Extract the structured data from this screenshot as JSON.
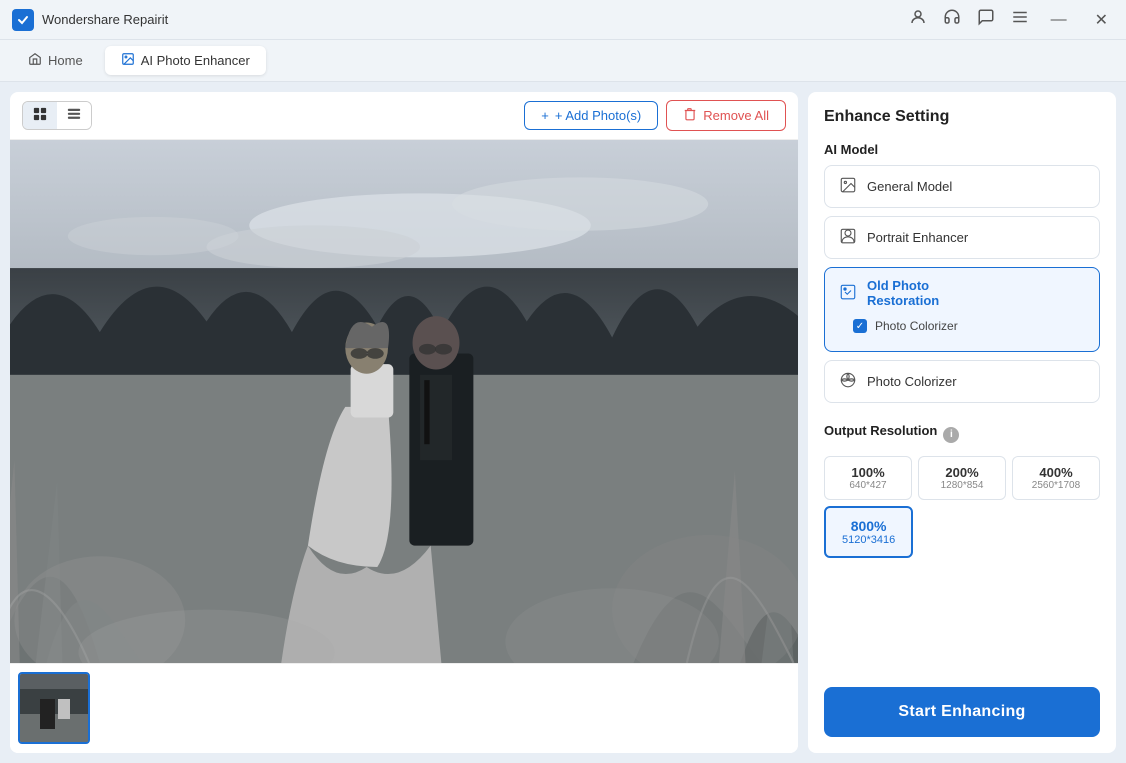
{
  "app": {
    "name": "Wondershare Repairit",
    "icon": "W"
  },
  "titlebar": {
    "controls": {
      "user_icon": "👤",
      "headphone_icon": "🎧",
      "chat_icon": "💬",
      "menu_icon": "☰",
      "minimize": "—",
      "close": "✕"
    }
  },
  "nav": {
    "home_label": "Home",
    "active_tab_label": "AI Photo Enhancer"
  },
  "toolbar": {
    "grid_view_active": true,
    "add_label": "+ Add Photo(s)",
    "remove_label": "Remove All"
  },
  "right_panel": {
    "title": "Enhance Setting",
    "ai_model_label": "AI Model",
    "models": [
      {
        "id": "general",
        "label": "General Model",
        "selected": false
      },
      {
        "id": "portrait",
        "label": "Portrait Enhancer",
        "selected": false
      },
      {
        "id": "old_photo",
        "label": "Old Photo Restoration",
        "selected": true
      },
      {
        "id": "colorizer",
        "label": "Photo Colorizer",
        "selected": false
      }
    ],
    "photo_colorizer_checkbox": {
      "label": "Photo Colorizer",
      "checked": true
    },
    "output_resolution_label": "Output Resolution",
    "resolutions": [
      {
        "id": "100",
        "percent": "100%",
        "dims": "640*427",
        "selected": false
      },
      {
        "id": "200",
        "percent": "200%",
        "dims": "1280*854",
        "selected": false
      },
      {
        "id": "400",
        "percent": "400%",
        "dims": "2560*1708",
        "selected": false
      },
      {
        "id": "800",
        "percent": "800%",
        "dims": "5120*3416",
        "selected": true
      }
    ],
    "start_button_label": "Start Enhancing"
  }
}
